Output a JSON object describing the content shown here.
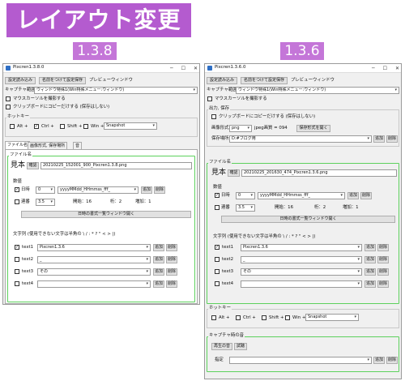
{
  "banner": {
    "title": "レイアウト変更"
  },
  "versions": {
    "left": "1.3.8",
    "right": "1.3.6"
  },
  "left": {
    "title": "Pixcren1.3.8.0",
    "toolbar": {
      "btn1": "設定読み込み",
      "btn2": "名前をつけて設定保存",
      "preview": "プレビューウィンドウ"
    },
    "capture": {
      "label": "キャプチャ範囲",
      "value": "ウィンドウ特殊1(Win特殊メニュー:ウィンドウ)"
    },
    "mouse": "マウスカーソルを撮影する",
    "clip": "クリップボードにコピーだけする (保存はしない)",
    "hotkey": {
      "title": "ホットキー",
      "alt": "Alt +",
      "ctrl": "Ctrl +",
      "shift": "Shift +",
      "win": "Win +",
      "key": "Snapshot"
    },
    "tabs": [
      "ファイル名",
      "画像形式, 保存場所",
      "音"
    ],
    "filename": {
      "title": "ファイル名",
      "sample_label": "見本",
      "confirm": "確認",
      "sample_value": "20210225_152001_900_Pixcren1.3.8.png",
      "number_title": "数値",
      "date_label": "日時",
      "date_n": "0",
      "date_fmt": "yyyyMMdd_HHmmss_fff_",
      "add": "追加",
      "del": "削除",
      "serial_label": "連番",
      "serial_n": "3.5",
      "start": "開始：16",
      "digits": "桁：2",
      "inc": "増加：1",
      "date_list_btn": "日時の書式一覧ウィンドウ開く",
      "str_title": "文字列 (使用できない文字は半角の \\ / : * ? \" < > |)",
      "texts": [
        {
          "label": "text1",
          "value": "Pixcren1.3.6",
          "on": true
        },
        {
          "label": "text2",
          "value": "_",
          "on": false
        },
        {
          "label": "text3",
          "value": "その",
          "on": false
        },
        {
          "label": "text4",
          "value": "",
          "on": false
        }
      ]
    }
  },
  "right": {
    "title": "Pixcren1.3.6.0",
    "toolbar": {
      "btn1": "設定読み込み",
      "btn2": "名前をつけて設定保存",
      "preview": "プレビューウィンドウ"
    },
    "capture": {
      "label": "キャプチャ範囲",
      "value": "ウィンドウ特殊1(Win特殊メニュー:ウィンドウ)"
    },
    "mouse": "マウスカーソルを撮影する",
    "output": {
      "title": "出力, 保存",
      "clip": "クリップボードにコピーだけする (保存はしない)",
      "format_label": "画像形式",
      "format": "png",
      "jpeg": "jpeg画質 = 094",
      "open_settings": "保存形式を開く",
      "save_label": "保存場所",
      "save_path": "D:#ブログ用"
    },
    "filename": {
      "title": "ファイル名",
      "sample_label": "見本",
      "confirm": "確認",
      "sample_value": "20210225_201630_474_Pixcren1.3.6.png",
      "number_title": "数値",
      "date_label": "日時",
      "date_n": "0",
      "date_fmt": "yyyyMMdd_HHmmss_fff_",
      "add": "追加",
      "del": "削除",
      "serial_label": "連番",
      "serial_n": "3.5",
      "start": "開始：16",
      "digits": "桁：2",
      "inc": "増加：1",
      "date_list_btn": "日時の書式一覧ウィンドウ開く",
      "str_title": "文字列 (使用できない文字は半角の \\ / : * ? \" < > |)",
      "texts": [
        {
          "label": "text1",
          "value": "Pixcren1.3.6",
          "on": true
        },
        {
          "label": "text2",
          "value": "_",
          "on": false
        },
        {
          "label": "text3",
          "value": "その",
          "on": false
        },
        {
          "label": "text4",
          "value": "",
          "on": false
        }
      ]
    },
    "hotkey": {
      "title": "ホットキー",
      "alt": "Alt +",
      "ctrl": "Ctrl +",
      "shift": "Shift +",
      "win": "Win +",
      "key": "Snapshot"
    },
    "sound": {
      "title": "キャプチャ時の音",
      "play": "再生の音",
      "test": "試聴",
      "spec_label": "指定"
    }
  }
}
